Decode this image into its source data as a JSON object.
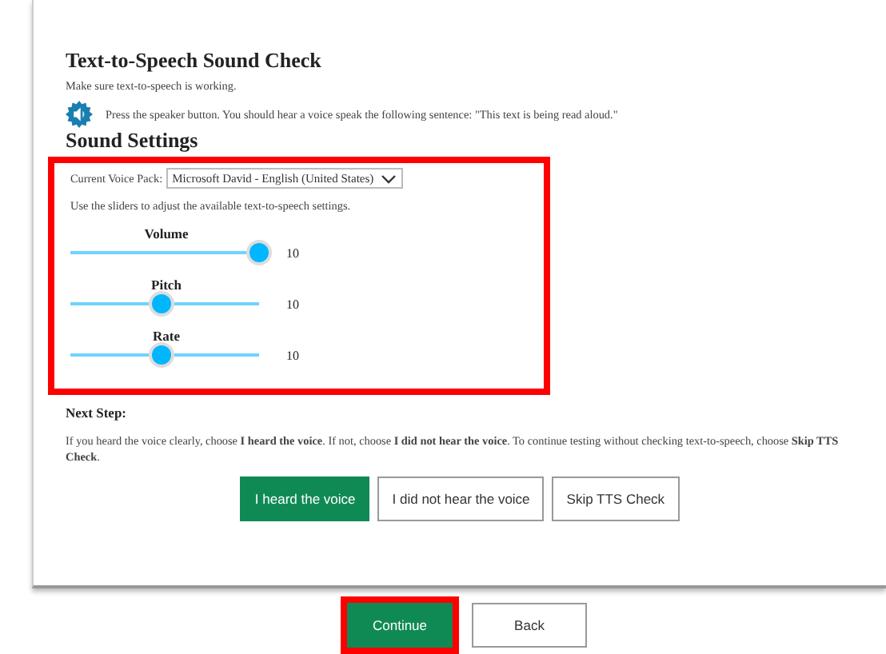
{
  "title": "Text-to-Speech Sound Check",
  "subtitle": "Make sure text-to-speech is working.",
  "instruction": "Press the speaker button. You should hear a voice speak the following sentence: \"This text is being read aloud.\"",
  "sound_settings": {
    "heading": "Sound Settings",
    "highlighted": true,
    "voice_pack_label": "Current Voice Pack:",
    "voice_pack": "Microsoft David - English (United States)",
    "hint": "Use the sliders to adjust the available text-to-speech settings.",
    "sliders": [
      {
        "label": "Volume",
        "level": 1.0,
        "reading": "10"
      },
      {
        "label": "Pitch",
        "level": 0.48,
        "reading": "10"
      },
      {
        "label": "Rate",
        "level": 0.48,
        "reading": "10"
      }
    ]
  },
  "next_step": {
    "heading": "Next Step:",
    "text": "If you heard the voice clearly, choose **I heard the voice**. If not, choose **I did not hear the voice**. To continue testing without checking text-to-speech, choose **Skip TTS Check**.",
    "buttons": [
      {
        "label": "I heard the voice",
        "kind": "primary"
      },
      {
        "label": "I did not hear the voice",
        "kind": "secondary"
      },
      {
        "label": "Skip TTS Check",
        "kind": "secondary"
      }
    ]
  },
  "footer_buttons": [
    {
      "label": "Continue",
      "kind": "primary",
      "highlighted": true
    },
    {
      "label": "Back",
      "kind": "secondary",
      "highlighted": false
    }
  ]
}
